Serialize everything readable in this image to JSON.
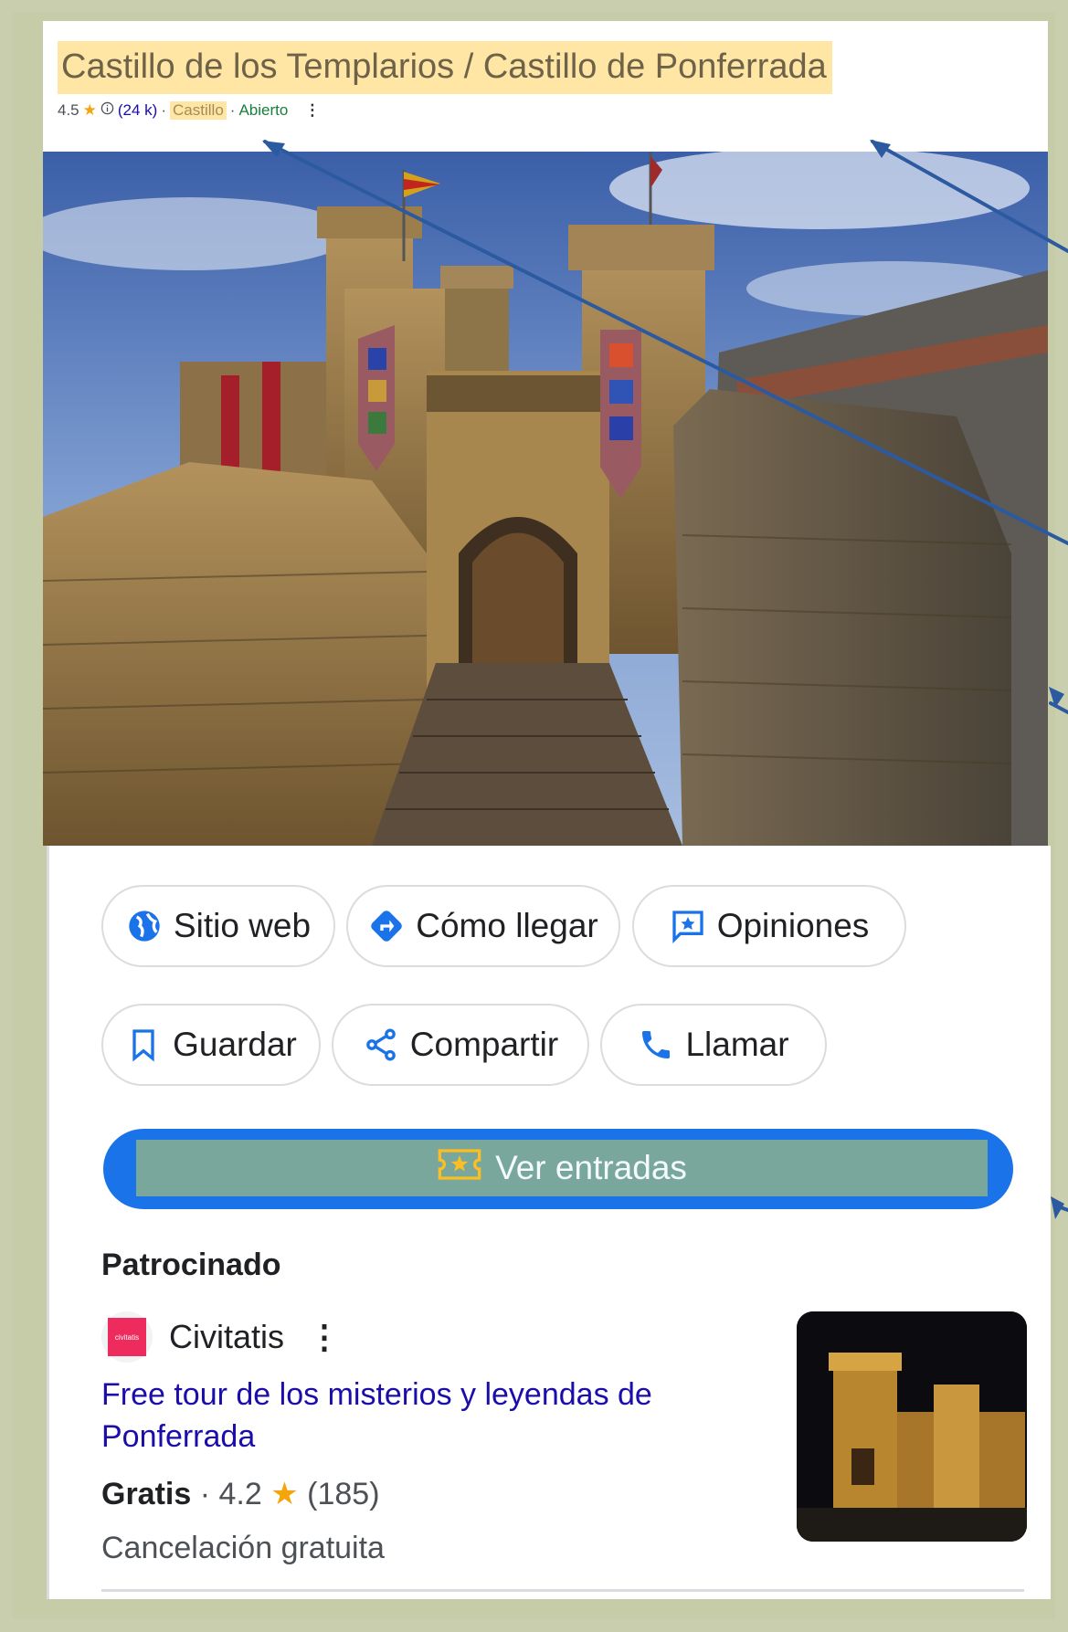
{
  "header": {
    "title": "Castillo de los Templarios / Castillo de Ponferrada",
    "rating": "4.5",
    "star": "★",
    "info_icon": "info-icon",
    "reviews": "(24 k)",
    "separator": "·",
    "category": "Castillo",
    "status": "Abierto",
    "more_icon": "⋮"
  },
  "photo": {
    "alt": "Castillo de los Templarios de Ponferrada"
  },
  "actions": {
    "row1": [
      {
        "label": "Sitio web",
        "icon": "globe-icon"
      },
      {
        "label": "Cómo llegar",
        "icon": "directions-icon"
      },
      {
        "label": "Opiniones",
        "icon": "review-icon"
      }
    ],
    "row2": [
      {
        "label": "Guardar",
        "icon": "bookmark-icon"
      },
      {
        "label": "Compartir",
        "icon": "share-icon"
      },
      {
        "label": "Llamar",
        "icon": "phone-icon"
      }
    ],
    "tickets": {
      "label": "Ver entradas",
      "icon": "ticket-icon"
    }
  },
  "sponsored": {
    "heading": "Patrocinado",
    "advertiser": "Civitatis",
    "logo_text": "civitatis",
    "more_icon": "⋮",
    "tour_title": "Free tour de los misterios y leyendas de Ponferrada",
    "price": "Gratis",
    "separator": "·",
    "rating": "4.2",
    "star": "★",
    "reviews": "(185)",
    "cancellation": "Cancelación gratuita"
  },
  "colors": {
    "highlight": "#ffe6a5",
    "accent_blue": "#1a73e8",
    "link": "#1a0dab",
    "open_green": "#188038",
    "arrow": "#2c5aa0"
  }
}
